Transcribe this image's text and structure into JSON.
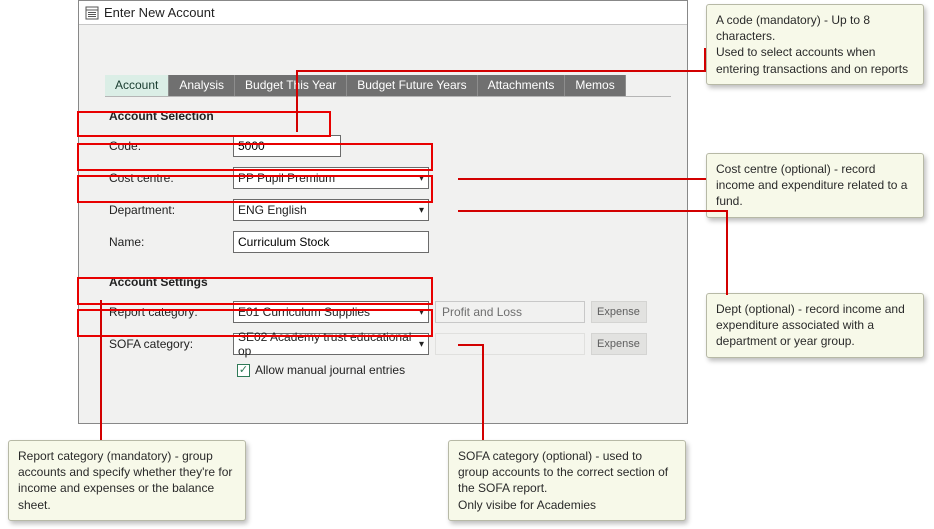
{
  "window": {
    "title": "Enter New Account"
  },
  "tabs": [
    "Account",
    "Analysis",
    "Budget This Year",
    "Budget Future Years",
    "Attachments",
    "Memos"
  ],
  "section1_title": "Account Selection",
  "labels": {
    "code": "Code:",
    "cost_centre": "Cost centre:",
    "department": "Department:",
    "name": "Name:",
    "report_category": "Report category:",
    "sofa_category": "SOFA category:"
  },
  "values": {
    "code": "5000",
    "cost_centre": "PP Pupil Premium",
    "department": "ENG English",
    "name": "Curriculum Stock",
    "report_category": "E01 Curriculum Supplies",
    "sofa_category": "SE02 Academy trust educational op",
    "report_type": "Profit and Loss",
    "report_side": "Expense",
    "sofa_side": "Expense",
    "allow_manual_label": "Allow manual journal entries"
  },
  "section2_title": "Account Settings",
  "callouts": {
    "code": "A code (mandatory) - Up to 8 characters.\nUsed to select accounts when entering transactions and on reports",
    "cost_centre": "Cost centre (optional)  - record income and expenditure related to a fund.",
    "department": "Dept (optional) - record income and expenditure associated with a department or year group.",
    "report_category": "Report category (mandatory) - group accounts and specify whether they're for income and expenses or the balance sheet.",
    "sofa_category": " SOFA category (optional)  - used to group accounts to the correct section of the SOFA report.\nOnly visibe for Academies"
  }
}
